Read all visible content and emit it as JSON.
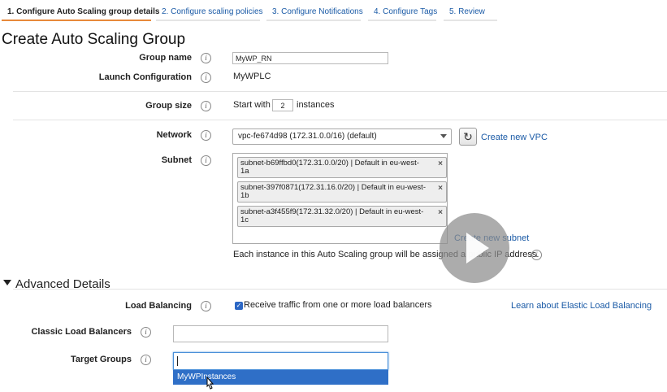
{
  "tabs": [
    {
      "label": "1. Configure Auto Scaling group details",
      "active": true
    },
    {
      "label": "2. Configure scaling policies",
      "active": false
    },
    {
      "label": "3. Configure Notifications",
      "active": false
    },
    {
      "label": "4. Configure Tags",
      "active": false
    },
    {
      "label": "5. Review",
      "active": false
    }
  ],
  "page_title": "Create Auto Scaling Group",
  "form": {
    "group_name": {
      "label": "Group name",
      "value": "MyWP_RN"
    },
    "launch_config": {
      "label": "Launch Configuration",
      "value": "MyWPLC"
    },
    "group_size": {
      "label": "Group size",
      "prefix": "Start with",
      "value": "2",
      "suffix": "instances"
    },
    "network": {
      "label": "Network",
      "value": "vpc-fe674d98 (172.31.0.0/16) (default)",
      "create_link": "Create new VPC"
    },
    "subnet": {
      "label": "Subnet",
      "items": [
        {
          "line1": "subnet-b69ffbd0(172.31.0.0/20) | Default in eu-west-",
          "line2": "1a"
        },
        {
          "line1": "subnet-397f0871(172.31.16.0/20) | Default in eu-west-",
          "line2": "1b"
        },
        {
          "line1": "subnet-a3f455f9(172.31.32.0/20) | Default in eu-west-",
          "line2": "1c"
        }
      ],
      "remove_glyph": "×",
      "create_link": "Create new subnet",
      "note": "Each instance in this Auto Scaling group will be assigned a public IP address."
    }
  },
  "advanced": {
    "title": "Advanced Details",
    "load_balancing": {
      "label": "Load Balancing",
      "checkbox_label": "Receive traffic from one or more load balancers",
      "checked": true,
      "learn_link": "Learn about Elastic Load Balancing"
    },
    "classic_lb": {
      "label": "Classic Load Balancers",
      "value": ""
    },
    "target_groups": {
      "label": "Target Groups",
      "value": "",
      "options": [
        "MyWPInstances"
      ]
    }
  },
  "icons": {
    "info": "i",
    "refresh": "↻",
    "check": "✓"
  },
  "colors": {
    "link": "#1a5aa6",
    "active_tab_underline": "#e7893a",
    "dropdown_highlight": "#2f6fc7"
  }
}
